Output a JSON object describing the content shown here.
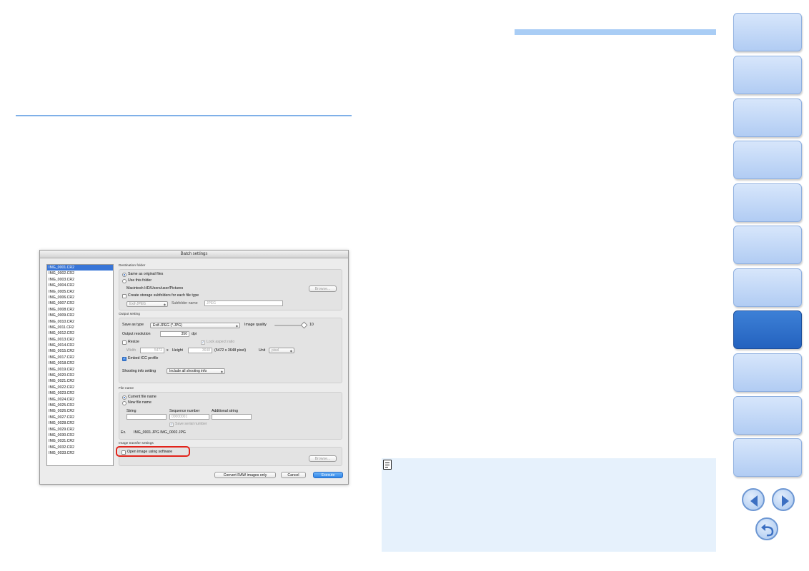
{
  "dialog": {
    "title": "Batch settings",
    "files": [
      "IMG_0001.CR2",
      "IMG_0002.CR2",
      "IMG_0003.CR2",
      "IMG_0004.CR2",
      "IMG_0005.CR2",
      "IMG_0006.CR2",
      "IMG_0007.CR2",
      "IMG_0008.CR2",
      "IMG_0009.CR2",
      "IMG_0010.CR2",
      "IMG_0011.CR2",
      "IMG_0012.CR2",
      "IMG_0013.CR2",
      "IMG_0014.CR2",
      "IMG_0015.CR2",
      "IMG_0017.CR2",
      "IMG_0018.CR2",
      "IMG_0019.CR2",
      "IMG_0020.CR2",
      "IMG_0021.CR2",
      "IMG_0022.CR2",
      "IMG_0023.CR2",
      "IMG_0024.CR2",
      "IMG_0025.CR2",
      "IMG_0026.CR2",
      "IMG_0027.CR2",
      "IMG_0028.CR2",
      "IMG_0029.CR2",
      "IMG_0030.CR2",
      "IMG_0031.CR2",
      "IMG_0032.CR2",
      "IMG_0033.CR2"
    ],
    "selected_file": "IMG_0001.CR2",
    "destination": {
      "title": "Destination folder",
      "same_as_original": "Same as original files",
      "use_this_folder": "Use this folder",
      "path": "Macintosh HD/Users/user/Pictures",
      "browse": "Browse...",
      "create_subfolders": "Create storage subfolders for each file type",
      "subfolder_type": "Exif-JPEG",
      "subfolder_name_label": "Subfolder name",
      "subfolder_name_value": "JPEG"
    },
    "output": {
      "title": "Output setting",
      "save_as_type_label": "Save as type",
      "save_as_type_value": "Exif-JPEG (*.JPG)",
      "image_quality_label": "Image quality",
      "image_quality_value": "10",
      "output_resolution_label": "Output resolution",
      "output_resolution_value": "350",
      "dpi": "dpi",
      "resize": "Resize",
      "lock_aspect": "Lock aspect ratio",
      "width_label": "Width",
      "width_value": "5472",
      "x": "x",
      "height_label": "Height",
      "height_value": "3648",
      "size_text": "(5472 x 3648 pixel)",
      "unit_label": "Unit",
      "unit_value": "pixel",
      "embed_icc": "Embed ICC profile",
      "shooting_info_label": "Shooting info setting",
      "shooting_info_value": "Include all shooting info"
    },
    "filename": {
      "title": "File name",
      "current": "Current file name",
      "new": "New file name",
      "string_label": "String",
      "sequence_label": "Sequence number",
      "sequence_value": "00000001",
      "additional_label": "Additional string",
      "save_serial": "Save serial number",
      "example_label": "Ex.",
      "example_value": "IMG_0001.JPG IMG_0002.JPG"
    },
    "transfer": {
      "title": "Image transfer settings",
      "open_software": "Open image using software",
      "browse": "Browse..."
    },
    "buttons": {
      "convert_raw": "Convert RAW images only",
      "cancel": "Cancel",
      "execute": "Execute"
    }
  },
  "colors": {
    "accent_line": "#7fb0e8",
    "note_bg": "#e6f1fc",
    "tab_active": "#2462bf",
    "highlight": "#e2231a"
  },
  "icons": {
    "note": "memo-icon",
    "prev": "arrow-left-icon",
    "next": "arrow-right-icon",
    "back": "return-icon"
  }
}
